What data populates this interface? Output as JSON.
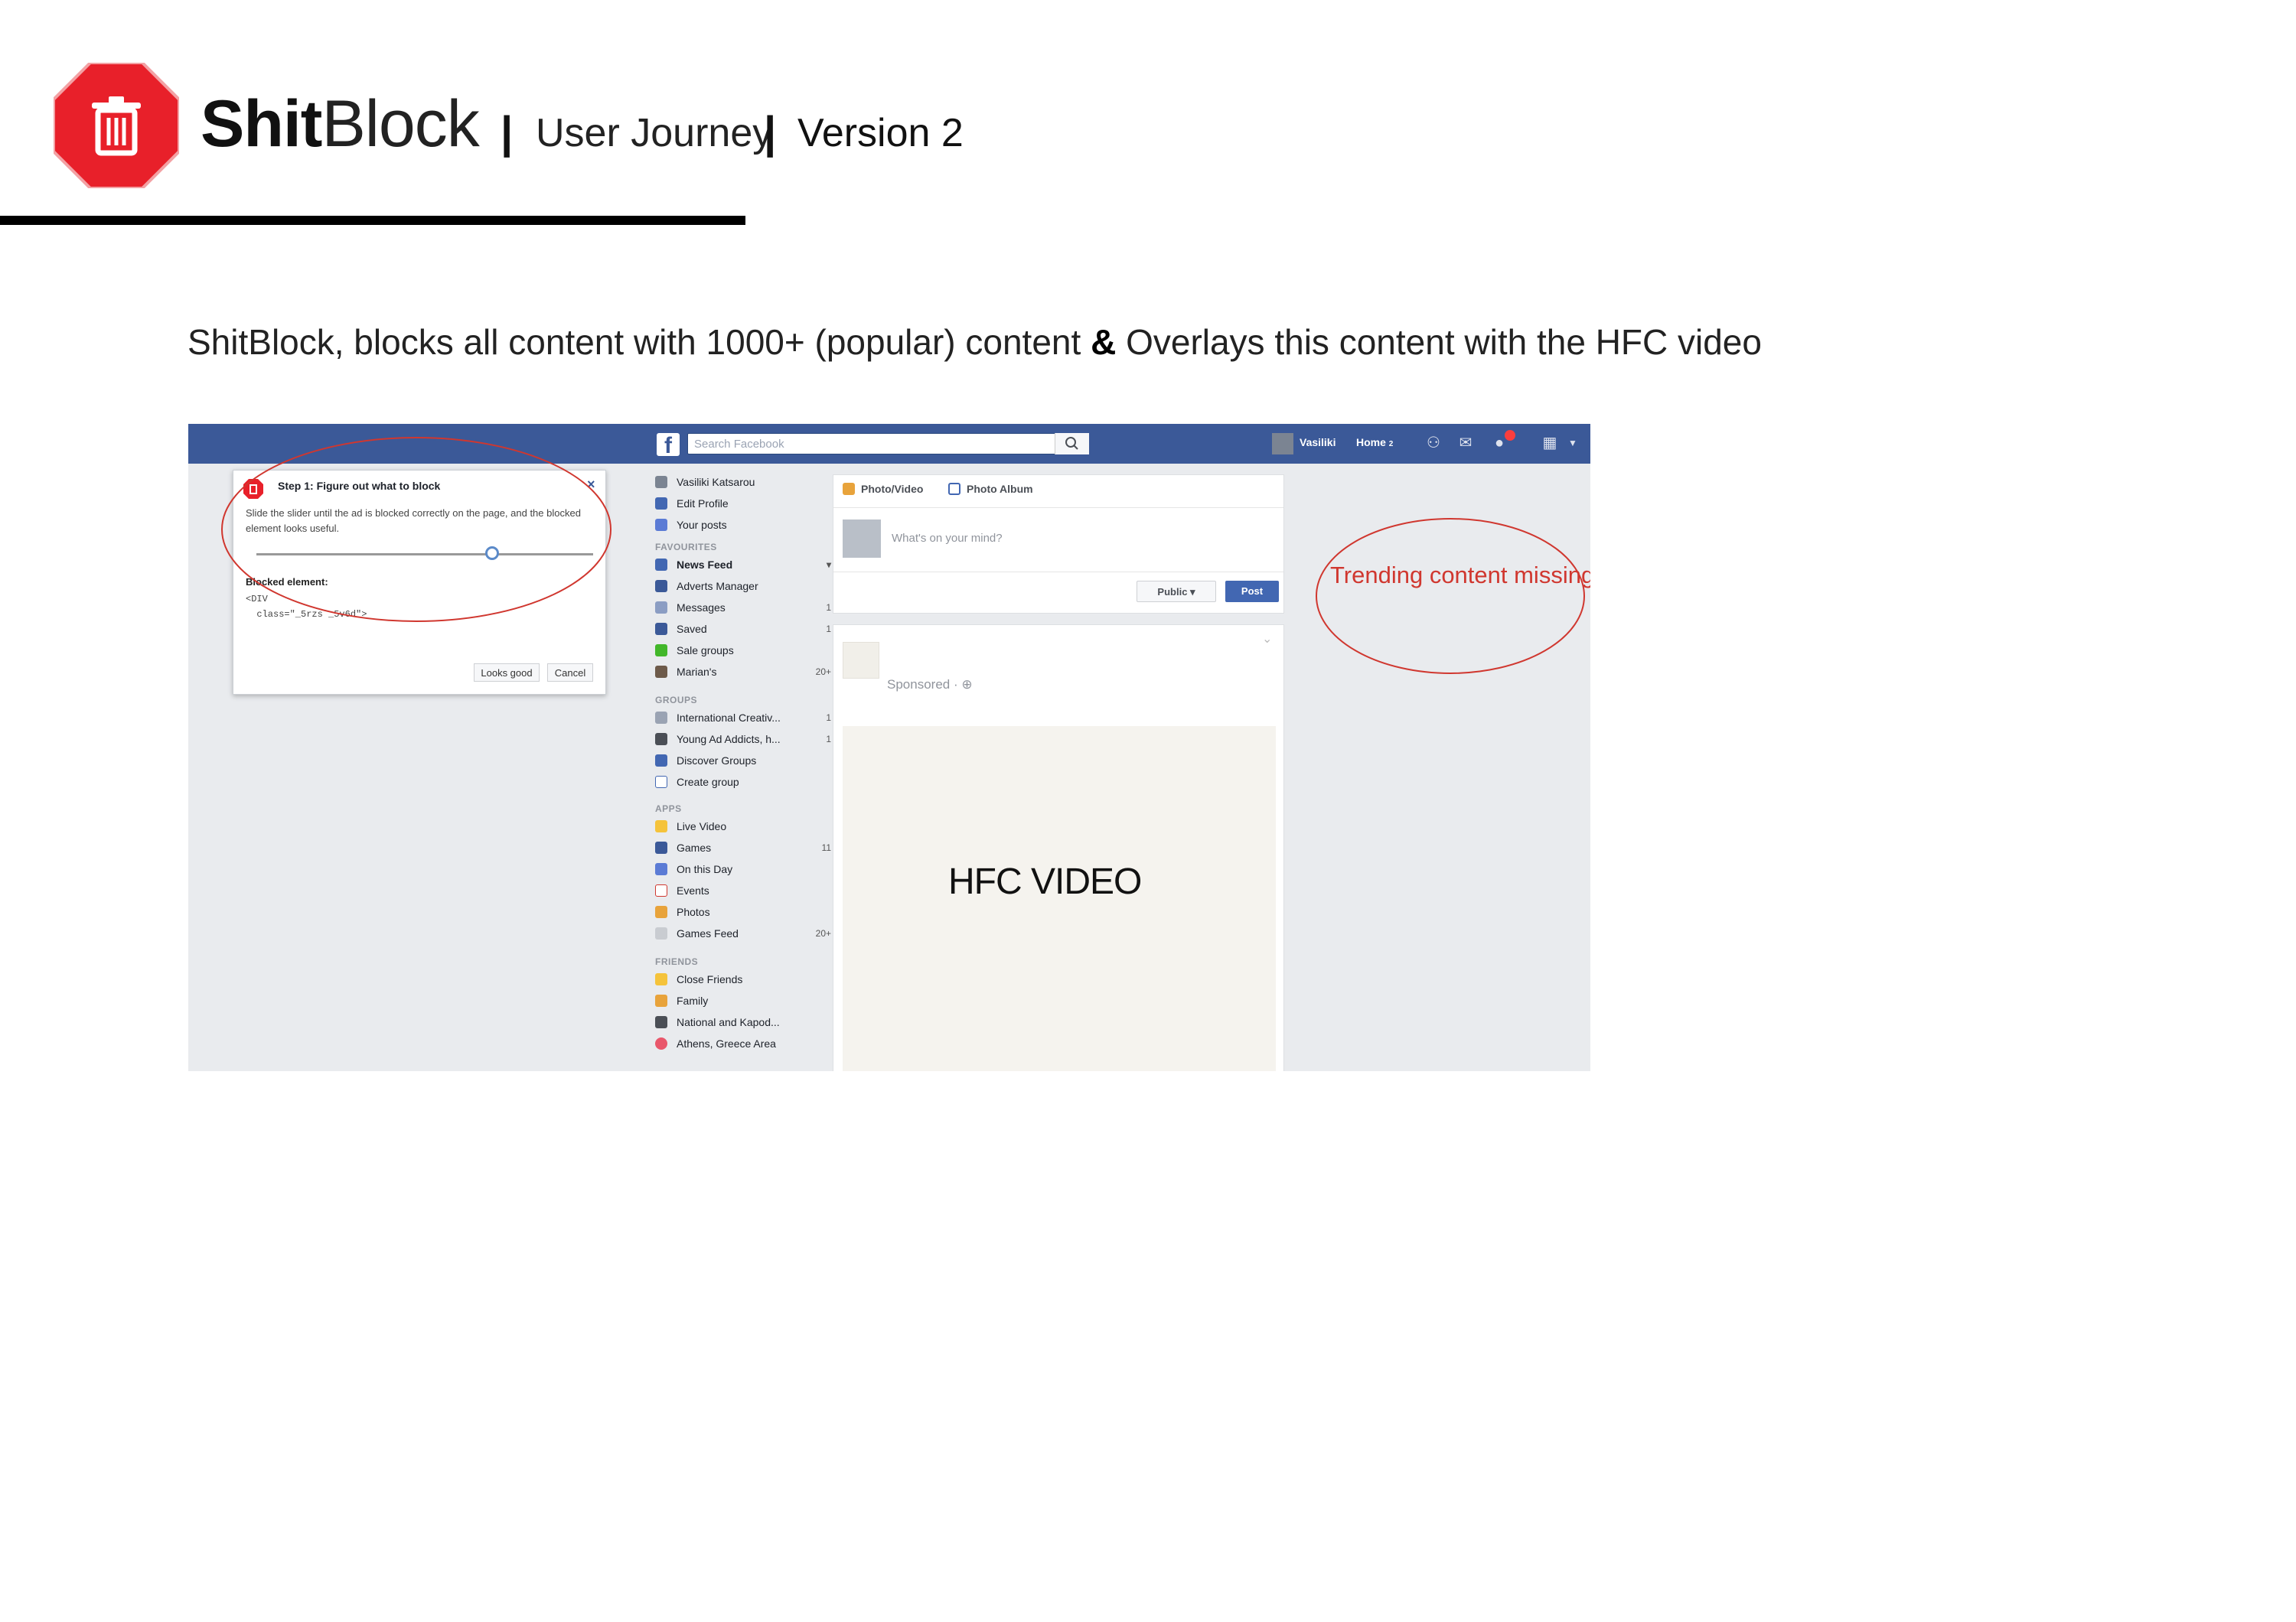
{
  "header": {
    "brand_bold": "Shit",
    "brand_light": "Block",
    "separator": "|",
    "section": "User Journey",
    "version": "Version 2",
    "logo_icon": "trash-icon",
    "logo_color": "#e8202a"
  },
  "description": {
    "before": "ShitBlock, blocks all content with 1000+ (popular) content ",
    "amp": "&",
    "after": " Overlays this content with the HFC video"
  },
  "facebook": {
    "search_placeholder": "Search Facebook",
    "user_name": "Vasiliki",
    "home_label": "Home",
    "home_count": "2",
    "left_nav": {
      "profile": [
        {
          "label": "Vasiliki Katsarou",
          "icon": "avatar-icon",
          "count": ""
        },
        {
          "label": "Edit Profile",
          "icon": "edit-icon",
          "count": ""
        },
        {
          "label": "Your posts",
          "icon": "user-icon",
          "count": ""
        }
      ],
      "favourites_heading": "FAVOURITES",
      "favourites": [
        {
          "label": "News Feed",
          "icon": "news-feed-icon",
          "count": ""
        },
        {
          "label": "Adverts Manager",
          "icon": "adverts-icon",
          "count": ""
        },
        {
          "label": "Messages",
          "icon": "messages-icon",
          "count": "1"
        },
        {
          "label": "Saved",
          "icon": "bookmark-icon",
          "count": "1"
        },
        {
          "label": "Sale groups",
          "icon": "sale-icon",
          "count": ""
        },
        {
          "label": "Marian's",
          "icon": "group-icon",
          "count": "20+"
        }
      ],
      "groups_heading": "GROUPS",
      "groups": [
        {
          "label": "International Creativ...",
          "icon": "group-icon",
          "count": "1"
        },
        {
          "label": "Young Ad Addicts, h...",
          "icon": "group-icon",
          "count": "1"
        },
        {
          "label": "Discover Groups",
          "icon": "discover-icon",
          "count": ""
        },
        {
          "label": "Create group",
          "icon": "plus-icon",
          "count": ""
        }
      ],
      "apps_heading": "APPS",
      "apps": [
        {
          "label": "Live Video",
          "icon": "live-video-icon",
          "count": ""
        },
        {
          "label": "Games",
          "icon": "games-icon",
          "count": "11"
        },
        {
          "label": "On this Day",
          "icon": "clock-icon",
          "count": ""
        },
        {
          "label": "Events",
          "icon": "calendar-icon",
          "count": ""
        },
        {
          "label": "Photos",
          "icon": "photos-icon",
          "count": ""
        },
        {
          "label": "Games Feed",
          "icon": "games-feed-icon",
          "count": "20+"
        }
      ],
      "friends_heading": "FRIENDS",
      "friends": [
        {
          "label": "Close Friends",
          "icon": "star-icon",
          "count": ""
        },
        {
          "label": "Family",
          "icon": "home-icon",
          "count": ""
        },
        {
          "label": "National and Kapod...",
          "icon": "school-icon",
          "count": ""
        },
        {
          "label": "Athens, Greece Area",
          "icon": "location-icon",
          "count": ""
        }
      ]
    },
    "composer": {
      "tab_photo": "Photo/Video",
      "tab_album": "Photo Album",
      "prompt": "What's on your mind?",
      "public_label": "Public ▾",
      "post_label": "Post"
    },
    "sponsored_label": "Sponsored · ⊕",
    "video_overlay": "HFC VIDEO",
    "annotation": "Trending content missing"
  },
  "popup": {
    "title": "Step 1: Figure out what to block",
    "close": "×",
    "instructions": "Slide the slider until the ad is blocked correctly on the page, and the blocked element looks useful.",
    "slider_value": 0.7,
    "element_label": "Blocked element:",
    "element_code": "<DIV\n  class=\"_5rzs _5v6d\">",
    "looks_good": "Looks good",
    "cancel": "Cancel"
  },
  "colors": {
    "fb_blue": "#3b5998",
    "annotation_red": "#d0372f",
    "post_button": "#4267b2"
  }
}
